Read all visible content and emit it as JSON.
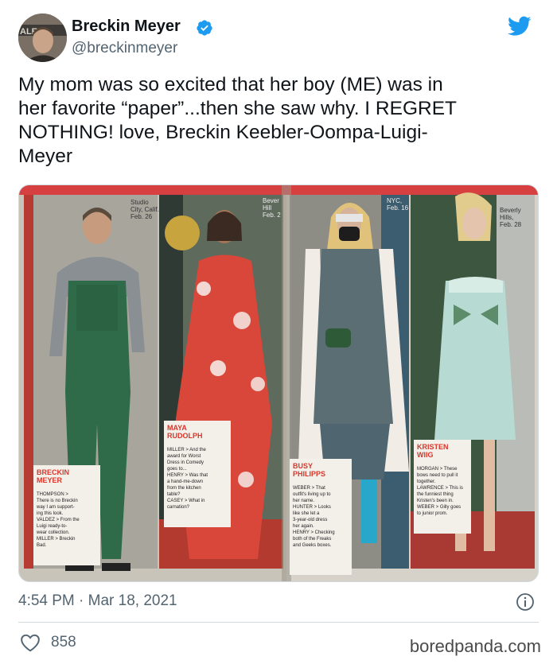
{
  "author": {
    "name": "Breckin Meyer",
    "handle": "@breckinmeyer",
    "verified_icon": "verified-badge-icon",
    "avatar_text": "ALE T"
  },
  "platform_icon": "twitter-bird-icon",
  "tweet": {
    "text": "My mom was so excited that her boy (ME) was in\nher favorite “paper”...then she saw why. I REGRET\nNOTHING! love, Breckin Keebler-Oompa-Luigi-\nMeyer"
  },
  "magazine": {
    "left_page": {
      "people": [
        {
          "dateline": [
            "Studio",
            "City, Calif.,",
            "Feb. 26"
          ],
          "name_lines": [
            "BRECKIN",
            "MEYER"
          ],
          "comments": [
            "THOMPSON >",
            "There is no Breckin",
            "way I am support-",
            "ing this look.",
            "VALDEZ > From the",
            "Luigi ready-to-",
            "wear collection.",
            "MILLER > Breckin",
            "Bad."
          ]
        },
        {
          "dateline": [
            "Bever",
            "Hill",
            "Feb. 2"
          ],
          "name_lines": [
            "MAYA",
            "RUDOLPH"
          ],
          "comments": [
            "MILLER > And the",
            "award for Worst",
            "Dress in Comedy",
            "goes to...",
            "HENRY > Was that",
            "a hand-me-down",
            "from the kitchen",
            "table?",
            "CASEY > What in",
            "carnation?"
          ]
        }
      ]
    },
    "right_page": {
      "people": [
        {
          "dateline": [
            "NYC,",
            "Feb. 16"
          ],
          "name_lines": [
            "BUSY",
            "PHILIPPS"
          ],
          "comments": [
            "WEBER > That",
            "outfit's living up to",
            "her name.",
            "HUNTER > Looks",
            "like she let a",
            "3-year-old dress",
            "her again.",
            "HENRY > Checking",
            "both of the Freaks",
            "and Geeks boxes."
          ]
        },
        {
          "dateline": [
            "Beverly",
            "Hills,",
            "Feb. 28"
          ],
          "name_lines": [
            "KRISTEN",
            "WIIG"
          ],
          "comments": [
            "MORGAN > These",
            "bows need to pull it",
            "together.",
            "LAWRENCE > This is",
            "the funniest thing",
            "Kristen's been in.",
            "WEBER > Gilly goes",
            "to junior prom."
          ]
        }
      ]
    }
  },
  "timestamp": "4:54 PM · Mar 18, 2021",
  "info_icon": "info-icon",
  "likes": {
    "icon": "heart-icon",
    "count": "858"
  },
  "watermark": "boredpanda.com",
  "colors": {
    "twitter_blue": "#1d9bf0",
    "text_primary": "#0f1419",
    "text_secondary": "#536471",
    "caption_red": "#d8362b"
  }
}
